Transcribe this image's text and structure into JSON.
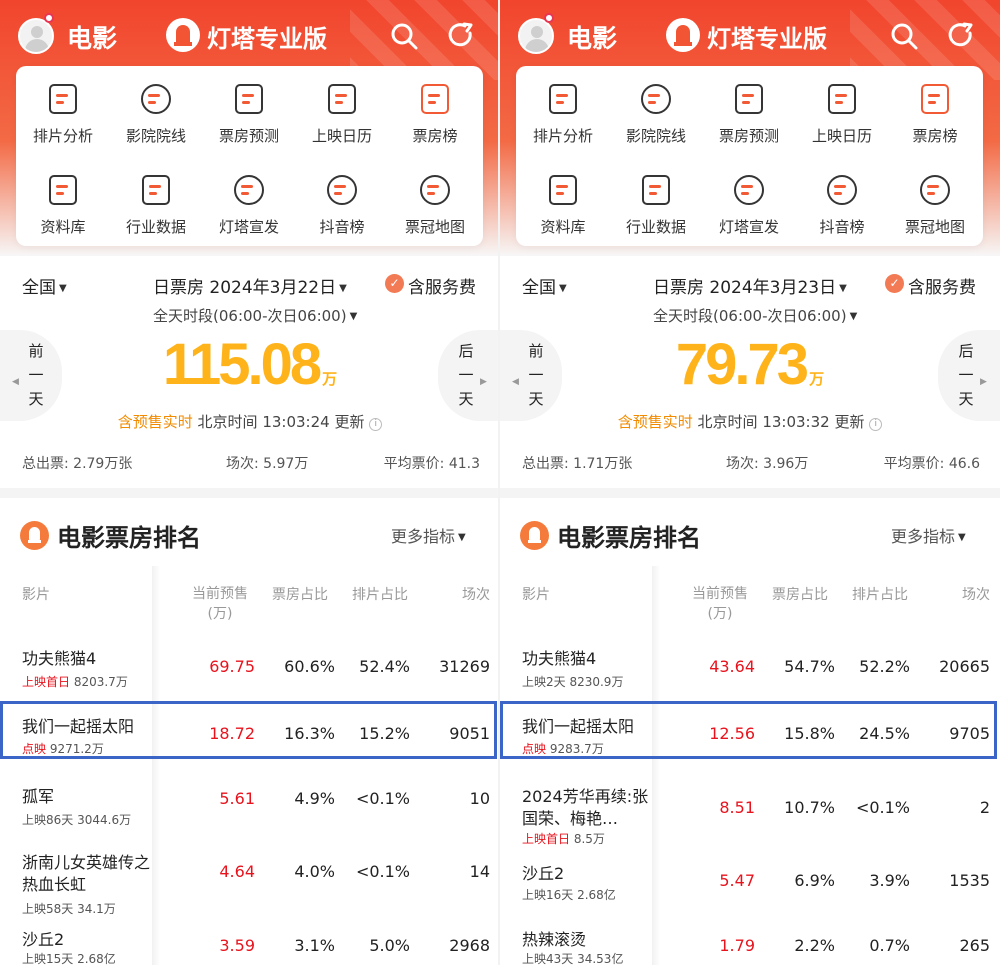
{
  "panels": [
    {
      "topbar": {
        "title": "电影",
        "brand": "灯塔专业版"
      },
      "menu": [
        {
          "label": "排片分析",
          "icon": "schedule-analysis-icon"
        },
        {
          "label": "影院院线",
          "icon": "cinema-chain-icon"
        },
        {
          "label": "票房预测",
          "icon": "box-office-forecast-icon"
        },
        {
          "label": "上映日历",
          "icon": "release-calendar-icon"
        },
        {
          "label": "票房榜",
          "icon": "box-office-chart-icon"
        },
        {
          "label": "资料库",
          "icon": "database-icon"
        },
        {
          "label": "行业数据",
          "icon": "industry-data-icon"
        },
        {
          "label": "灯塔宣发",
          "icon": "lighthouse-publicity-icon"
        },
        {
          "label": "抖音榜",
          "icon": "tiktok-chart-icon"
        },
        {
          "label": "票冠地图",
          "icon": "box-office-map-icon"
        }
      ],
      "summary": {
        "region": "全国",
        "date": "日票房 2024年3月22日",
        "service": "含服务费",
        "period": "全天时段(06:00-次日06:00)",
        "prev": [
          "前",
          "一",
          "天"
        ],
        "next": [
          "后",
          "一",
          "天"
        ],
        "value": "115.08",
        "unit": "万",
        "live_prefix": "含预售实时",
        "live_time": " 北京时间 13:03:24 更新 ",
        "stats": [
          "总出票: 2.79万张",
          "场次: 5.97万",
          "平均票价: 41.3"
        ]
      },
      "ranking": {
        "title": "电影票房排名",
        "more": "更多指标",
        "headers": {
          "film": "影片",
          "presale_1": "当前预售",
          "presale_2": "(万)",
          "share": "票房占比",
          "schedule": "排片占比",
          "shows": "场次"
        },
        "rows": [
          {
            "name": "功夫熊猫4",
            "status": "上映首日",
            "total": " 8203.7万",
            "presale": "69.75",
            "share": "60.6%",
            "schedule": "52.4%",
            "shows": "31269"
          },
          {
            "name": "我们一起摇太阳",
            "status": "点映",
            "total": " 9271.2万",
            "presale": "18.72",
            "share": "16.3%",
            "schedule": "15.2%",
            "shows": "9051"
          },
          {
            "name": "孤军",
            "status": "",
            "total": "上映86天 3044.6万",
            "presale": "5.61",
            "share": "4.9%",
            "schedule": "<0.1%",
            "shows": "10"
          },
          {
            "name": "浙南儿女英雄传之热血长虹",
            "status": "",
            "total": "上映58天 34.1万",
            "presale": "4.64",
            "share": "4.0%",
            "schedule": "<0.1%",
            "shows": "14"
          },
          {
            "name": "沙丘2",
            "status": "",
            "total": "上映15天 2.68亿",
            "presale": "3.59",
            "share": "3.1%",
            "schedule": "5.0%",
            "shows": "2968"
          }
        ]
      }
    },
    {
      "topbar": {
        "title": "电影",
        "brand": "灯塔专业版"
      },
      "menu": [
        {
          "label": "排片分析",
          "icon": "schedule-analysis-icon"
        },
        {
          "label": "影院院线",
          "icon": "cinema-chain-icon"
        },
        {
          "label": "票房预测",
          "icon": "box-office-forecast-icon"
        },
        {
          "label": "上映日历",
          "icon": "release-calendar-icon"
        },
        {
          "label": "票房榜",
          "icon": "box-office-chart-icon"
        },
        {
          "label": "资料库",
          "icon": "database-icon"
        },
        {
          "label": "行业数据",
          "icon": "industry-data-icon"
        },
        {
          "label": "灯塔宣发",
          "icon": "lighthouse-publicity-icon"
        },
        {
          "label": "抖音榜",
          "icon": "tiktok-chart-icon"
        },
        {
          "label": "票冠地图",
          "icon": "box-office-map-icon"
        }
      ],
      "summary": {
        "region": "全国",
        "date": "日票房 2024年3月23日",
        "service": "含服务费",
        "period": "全天时段(06:00-次日06:00)",
        "prev": [
          "前",
          "一",
          "天"
        ],
        "next": [
          "后",
          "一",
          "天"
        ],
        "value": "79.73",
        "unit": "万",
        "live_prefix": "含预售实时",
        "live_time": " 北京时间 13:03:32 更新 ",
        "stats": [
          "总出票: 1.71万张",
          "场次: 3.96万",
          "平均票价: 46.6"
        ]
      },
      "ranking": {
        "title": "电影票房排名",
        "more": "更多指标",
        "headers": {
          "film": "影片",
          "presale_1": "当前预售",
          "presale_2": "(万)",
          "share": "票房占比",
          "schedule": "排片占比",
          "shows": "场次"
        },
        "rows": [
          {
            "name": "功夫熊猫4",
            "status": "",
            "total": "上映2天 8230.9万",
            "presale": "43.64",
            "share": "54.7%",
            "schedule": "52.2%",
            "shows": "20665"
          },
          {
            "name": "我们一起摇太阳",
            "status": "点映",
            "total": " 9283.7万",
            "presale": "12.56",
            "share": "15.8%",
            "schedule": "24.5%",
            "shows": "9705"
          },
          {
            "name": "2024芳华再续:张国荣、梅艳…",
            "status": "上映首日",
            "total": " 8.5万",
            "presale": "8.51",
            "share": "10.7%",
            "schedule": "<0.1%",
            "shows": "2"
          },
          {
            "name": "沙丘2",
            "status": "",
            "total": "上映16天 2.68亿",
            "presale": "5.47",
            "share": "6.9%",
            "schedule": "3.9%",
            "shows": "1535"
          },
          {
            "name": "热辣滚烫",
            "status": "",
            "total": "上映43天 34.53亿",
            "presale": "1.79",
            "share": "2.2%",
            "schedule": "0.7%",
            "shows": "265"
          }
        ]
      }
    }
  ],
  "colors": {
    "header": "#f1452d",
    "value": "#ffb31a",
    "presale": "#e8131d",
    "highlight": "#3b66c8"
  }
}
